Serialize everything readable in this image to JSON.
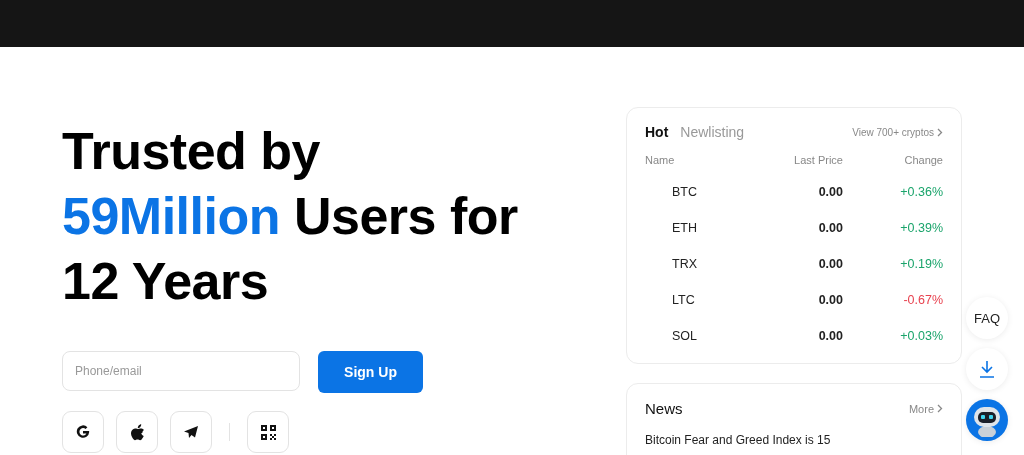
{
  "hero": {
    "headline": [
      [
        {
          "text": "Trusted by",
          "highlight": false
        }
      ],
      [
        {
          "text": "59Million",
          "highlight": true
        },
        {
          "text": " Users for",
          "highlight": false
        }
      ],
      [
        {
          "text": "12 Years",
          "highlight": false
        }
      ]
    ],
    "signup": {
      "placeholder": "Phone/email",
      "button": "Sign Up"
    }
  },
  "market": {
    "tabs": [
      {
        "label": "Hot",
        "selected": true
      },
      {
        "label": "Newlisting",
        "selected": false
      }
    ],
    "view_all": "View 700+ cryptos",
    "columns": [
      "Name",
      "Last Price",
      "Change"
    ],
    "rows": [
      {
        "name": "BTC",
        "price": "0.00",
        "change": "+0.36%",
        "color": "#1aa46b"
      },
      {
        "name": "ETH",
        "price": "0.00",
        "change": "+0.39%",
        "color": "#1aa46b"
      },
      {
        "name": "TRX",
        "price": "0.00",
        "change": "+0.19%",
        "color": "#1aa46b"
      },
      {
        "name": "LTC",
        "price": "0.00",
        "change": "-0.67%",
        "color": "#e8424f"
      },
      {
        "name": "SOL",
        "price": "0.00",
        "change": "+0.03%",
        "color": "#1aa46b"
      }
    ]
  },
  "news": {
    "title": "News",
    "more": "More",
    "items": [
      "Bitcoin Fear and Greed Index is 15"
    ]
  },
  "float": {
    "faq": "FAQ"
  }
}
